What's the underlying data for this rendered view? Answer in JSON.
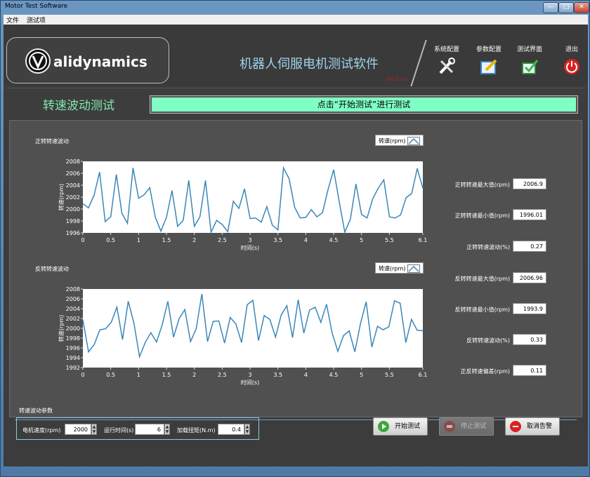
{
  "window": {
    "title": "Motor Test Software"
  },
  "menu": [
    "文件",
    "测试项"
  ],
  "brand": {
    "logo_text": "alidynamics"
  },
  "header": {
    "app_title": "机器人伺服电机测试软件",
    "version": "2013.2.x"
  },
  "nav": [
    {
      "label": "系统配置",
      "icon": "wrench-icon"
    },
    {
      "label": "参数配置",
      "icon": "edit-icon"
    },
    {
      "label": "测试界面",
      "icon": "check-icon"
    },
    {
      "label": "退出",
      "icon": "power-icon"
    }
  ],
  "section": {
    "title": "转速波动测试",
    "status": "点击“开始测试”进行测试"
  },
  "legend_label": "转速(rpm)",
  "charts": [
    {
      "title": "正转转速波动",
      "ylabel": "转速(rpm)",
      "xlabel": "时间(s)",
      "ylim": [
        1996,
        2008
      ],
      "yticks": [
        1996,
        1998,
        2000,
        2002,
        2004,
        2006,
        2008
      ],
      "xlim": [
        0,
        6.1
      ],
      "xticks": [
        "0",
        "0.5",
        "1",
        "1.5",
        "2",
        "2.5",
        "3",
        "3.5",
        "4",
        "4.5",
        "5",
        "5.5",
        "6.1"
      ],
      "values": [
        2000.9,
        2000.2,
        2002.3,
        2006.2,
        1997.9,
        1998.7,
        2005.8,
        1999.3,
        1997.6,
        2006.9,
        2001.8,
        2002.4,
        2003.6,
        1998.6,
        1996.3,
        1998.6,
        2003.1,
        1997.1,
        1998.1,
        2004.8,
        1997.1,
        1998.7,
        2004.8,
        1996.1,
        1998.1,
        1997.4,
        1996.2,
        2001.3,
        2000.1,
        2003.4,
        1998.4,
        1998.5,
        1997.8,
        2000.4,
        1997.3,
        1996.5,
        2006.9,
        2005.1,
        2000.3,
        1998.5,
        1998.6,
        1999.9,
        1998.7,
        1999.4,
        2003.3,
        2006.6,
        2001.2,
        1996.1,
        1998.3,
        2004.2,
        1999.1,
        1998.5,
        2001.7,
        2003.5,
        2004.9,
        1998.7,
        1998.5,
        1999.0,
        2001.9,
        2002.6,
        2006.8,
        2003.5
      ]
    },
    {
      "title": "反转转速波动",
      "ylabel": "转速(rpm)",
      "xlabel": "时间(s)",
      "ylim": [
        1992,
        2008
      ],
      "yticks": [
        1992,
        1994,
        1996,
        1998,
        2000,
        2002,
        2004,
        2006,
        2008
      ],
      "xlim": [
        0,
        6.1
      ],
      "xticks": [
        "0",
        "0.5",
        "1",
        "1.5",
        "2",
        "2.5",
        "3",
        "3.5",
        "4",
        "4.5",
        "5",
        "5.5",
        "6.1"
      ],
      "values": [
        2001.7,
        1995.2,
        1996.7,
        1999.7,
        1999.9,
        2001.2,
        2004.3,
        1997.7,
        2005.5,
        2001.1,
        1994.2,
        1997.1,
        1999.1,
        1997.2,
        2000.7,
        2005.5,
        1998.2,
        2002.0,
        2003.8,
        1997.3,
        1999.9,
        2007.0,
        1997.3,
        2001.4,
        2001.5,
        1997.0,
        2002.2,
        2000.9,
        1997.1,
        2004.8,
        2005.7,
        1997.5,
        2002.6,
        2001.8,
        1998.2,
        2002.7,
        2004.6,
        1998.1,
        2005.8,
        1999.0,
        2003.7,
        2004.3,
        2001.2,
        2004.9,
        1999.0,
        1995.3,
        1998.5,
        1999.5,
        1995.2,
        2001.0,
        2005.4,
        1996.2,
        2000.4,
        1999.7,
        2000.3,
        2005.6,
        2005.1,
        1997.1,
        2001.8,
        1999.6,
        1999.5
      ]
    }
  ],
  "stats": [
    {
      "label": "正转转速最大值(rpm)",
      "value": "2006.9"
    },
    {
      "label": "正转转速最小值(rpm)",
      "value": "1996.01"
    },
    {
      "label": "正转转速波动(%)",
      "value": "0.27"
    },
    {
      "label": "反转转速最大值(rpm)",
      "value": "2006.96"
    },
    {
      "label": "反转转速最小值(rpm)",
      "value": "1993.9"
    },
    {
      "label": "反转转速波动(%)",
      "value": "0.33"
    },
    {
      "label": "正反转速偏差(rpm)",
      "value": "0.11"
    }
  ],
  "params": {
    "title": "转速波动参数",
    "speed_label": "电机速度(rpm)",
    "speed": "2000",
    "time_label": "运行时间(s)",
    "time": "6",
    "torque_label": "加载扭矩(N.m)",
    "torque": "0.4"
  },
  "buttons": {
    "start": "开始测试",
    "stop": "停止测试",
    "cancel_alarm": "取消告警"
  },
  "colors": {
    "series": "#3a87b8",
    "status_bg": "#7fffc4",
    "title_green": "#7fe6b0",
    "app_title": "#9fd3ea"
  }
}
